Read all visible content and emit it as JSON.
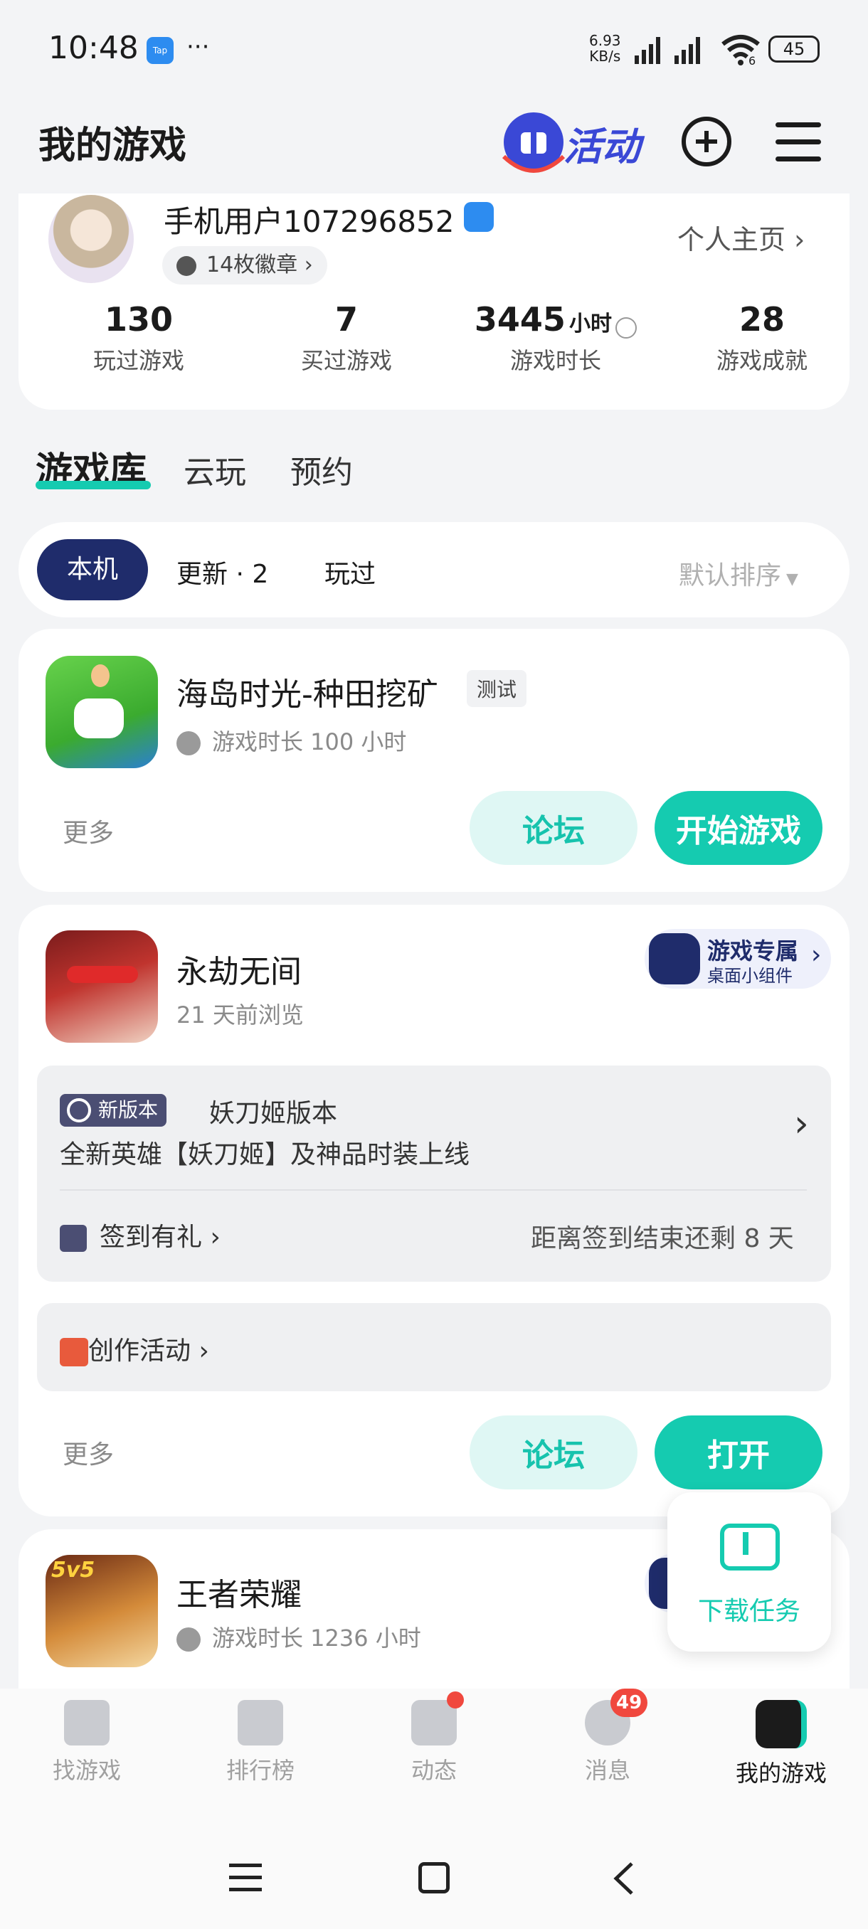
{
  "status_bar": {
    "time": "10:48",
    "app_badge": "Tap",
    "dots": "···",
    "net_speed_value": "6.93",
    "net_speed_unit": "KB/s",
    "wifi_sub": "6",
    "battery": "45"
  },
  "header": {
    "title": "我的游戏",
    "activity_label": "活动"
  },
  "profile": {
    "username": "手机用户107296852",
    "badges": "14枚徽章",
    "homepage_link": "个人主页",
    "stats": [
      {
        "value": "130",
        "unit": "",
        "label": "玩过游戏"
      },
      {
        "value": "7",
        "unit": "",
        "label": "买过游戏"
      },
      {
        "value": "3445",
        "unit": "小时",
        "label": "游戏时长"
      },
      {
        "value": "28",
        "unit": "",
        "label": "游戏成就"
      }
    ]
  },
  "library_tabs": [
    "游戏库",
    "云玩",
    "预约"
  ],
  "filters": {
    "chips": [
      "本机",
      "更新 · 2",
      "玩过"
    ],
    "sort": "默认排序"
  },
  "games": [
    {
      "name": "海岛时光-种田挖矿",
      "tag": "测试",
      "sub": "游戏时长 100 小时",
      "more": "更多",
      "forum": "论坛",
      "action": "开始游戏"
    },
    {
      "name": "永劫无间",
      "sub": "21 天前浏览",
      "widget_title": "游戏专属",
      "widget_sub": "桌面小组件",
      "version_badge": "新版本",
      "version_title": "妖刀姬版本",
      "version_desc": "全新英雄【妖刀姬】及神品时装上线",
      "signin_label": "签到有礼",
      "signin_remain": "距离签到结束还剩 8 天",
      "creation_label": "创作活动",
      "more": "更多",
      "forum": "论坛",
      "action": "打开"
    },
    {
      "name": "王者荣耀",
      "sub": "游戏时长 1236 小时",
      "icon_text": "5v5"
    }
  ],
  "floating": {
    "download_label": "下载任务"
  },
  "bottom_nav": [
    {
      "label": "找游戏"
    },
    {
      "label": "排行榜"
    },
    {
      "label": "动态"
    },
    {
      "label": "消息",
      "badge": "49"
    },
    {
      "label": "我的游戏"
    }
  ],
  "colors": {
    "accent": "#15cbb0",
    "chip_active": "#1f2c6b",
    "badge_red": "#f0483e"
  }
}
